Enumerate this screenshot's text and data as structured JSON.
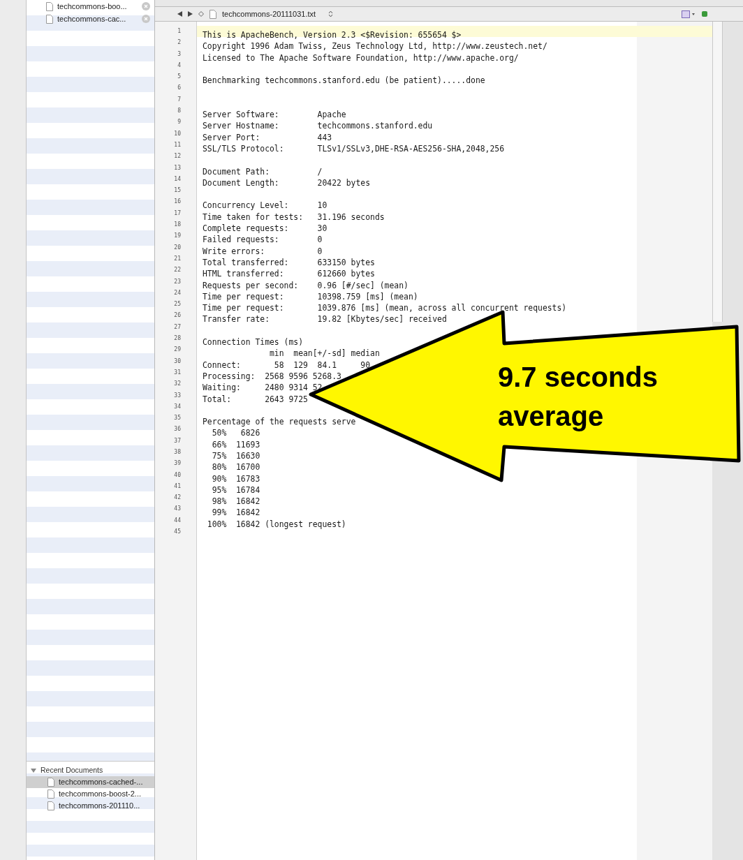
{
  "sidebar": {
    "open_files": [
      {
        "name": "techcommons-boo..."
      },
      {
        "name": "techcommons-cac..."
      }
    ],
    "recent": {
      "title": "Recent Documents",
      "expanded": true,
      "items": [
        {
          "name": "techcommons-cached-...",
          "selected": true
        },
        {
          "name": "techcommons-boost-2...",
          "selected": false
        },
        {
          "name": "techcommons-201110...",
          "selected": false
        }
      ]
    }
  },
  "editor": {
    "file_name": "techcommons-20111031.txt",
    "lines": [
      {
        "number": "1",
        "text": "This is ApacheBench, Version 2.3 <$Revision: 655654 $>",
        "current": true
      },
      {
        "number": "2",
        "text": "Copyright 1996 Adam Twiss, Zeus Technology Ltd, http://www.zeustech.net/",
        "current": false
      },
      {
        "number": "3",
        "text": "Licensed to The Apache Software Foundation, http://www.apache.org/",
        "current": false
      },
      {
        "number": "4",
        "current": false
      },
      {
        "number": "5",
        "text": "Benchmarking techcommons.stanford.edu (be patient).....done",
        "current": false
      },
      {
        "number": "6",
        "current": false
      },
      {
        "number": "7",
        "current": false
      },
      {
        "number": "8",
        "text": "Server Software:        Apache",
        "current": false
      },
      {
        "number": "9",
        "text": "Server Hostname:        techcommons.stanford.edu",
        "current": false
      },
      {
        "number": "10",
        "text": "Server Port:            443",
        "current": false
      },
      {
        "number": "11",
        "text": "SSL/TLS Protocol:       TLSv1/SSLv3,DHE-RSA-AES256-SHA,2048,256",
        "current": false
      },
      {
        "number": "12",
        "current": false
      },
      {
        "number": "13",
        "text": "Document Path:          /",
        "current": false
      },
      {
        "number": "14",
        "text": "Document Length:        20422 bytes",
        "current": false
      },
      {
        "number": "15",
        "current": false
      },
      {
        "number": "16",
        "text": "Concurrency Level:      10",
        "current": false
      },
      {
        "number": "17",
        "text": "Time taken for tests:   31.196 seconds",
        "current": false
      },
      {
        "number": "18",
        "text": "Complete requests:      30",
        "current": false
      },
      {
        "number": "19",
        "text": "Failed requests:        0",
        "current": false
      },
      {
        "number": "20",
        "text": "Write errors:           0",
        "current": false
      },
      {
        "number": "21",
        "text": "Total transferred:      633150 bytes",
        "current": false
      },
      {
        "number": "22",
        "text": "HTML transferred:       612660 bytes",
        "current": false
      },
      {
        "number": "23",
        "text": "Requests per second:    0.96 [#/sec] (mean)",
        "current": false
      },
      {
        "number": "24",
        "text": "Time per request:       10398.759 [ms] (mean)",
        "current": false
      },
      {
        "number": "25",
        "text": "Time per request:       1039.876 [ms] (mean, across all concurrent requests)",
        "current": false
      },
      {
        "number": "26",
        "text": "Transfer rate:          19.82 [Kbytes/sec] received",
        "current": false
      },
      {
        "number": "27",
        "current": false
      },
      {
        "number": "28",
        "text": "Connection Times (ms)",
        "current": false
      },
      {
        "number": "29",
        "text": "              min  mean[+/-sd] median",
        "current": false
      },
      {
        "number": "30",
        "text": "Connect:       58  129  84.1     90",
        "current": false
      },
      {
        "number": "31",
        "text": "Processing:  2568 9596 5268.3",
        "current": false
      },
      {
        "number": "32",
        "text": "Waiting:     2480 9314 52",
        "current": false
      },
      {
        "number": "33",
        "text": "Total:       2643 9725",
        "current": false
      },
      {
        "number": "34",
        "current": false
      },
      {
        "number": "35",
        "text": "Percentage of the requests serve",
        "current": false
      },
      {
        "number": "36",
        "text": "  50%   6826",
        "current": false
      },
      {
        "number": "37",
        "text": "  66%  11693",
        "current": false
      },
      {
        "number": "38",
        "text": "  75%  16630",
        "current": false
      },
      {
        "number": "39",
        "text": "  80%  16700",
        "current": false
      },
      {
        "number": "40",
        "text": "  90%  16783",
        "current": false
      },
      {
        "number": "41",
        "text": "  95%  16784",
        "current": false
      },
      {
        "number": "42",
        "text": "  98%  16842",
        "current": false
      },
      {
        "number": "43",
        "text": "  99%  16842",
        "current": false
      },
      {
        "number": "44",
        "text": " 100%  16842 (longest request)",
        "current": false
      },
      {
        "number": "45",
        "current": false
      }
    ]
  },
  "callout": {
    "lines": [
      "9.7 seconds",
      "average"
    ]
  }
}
